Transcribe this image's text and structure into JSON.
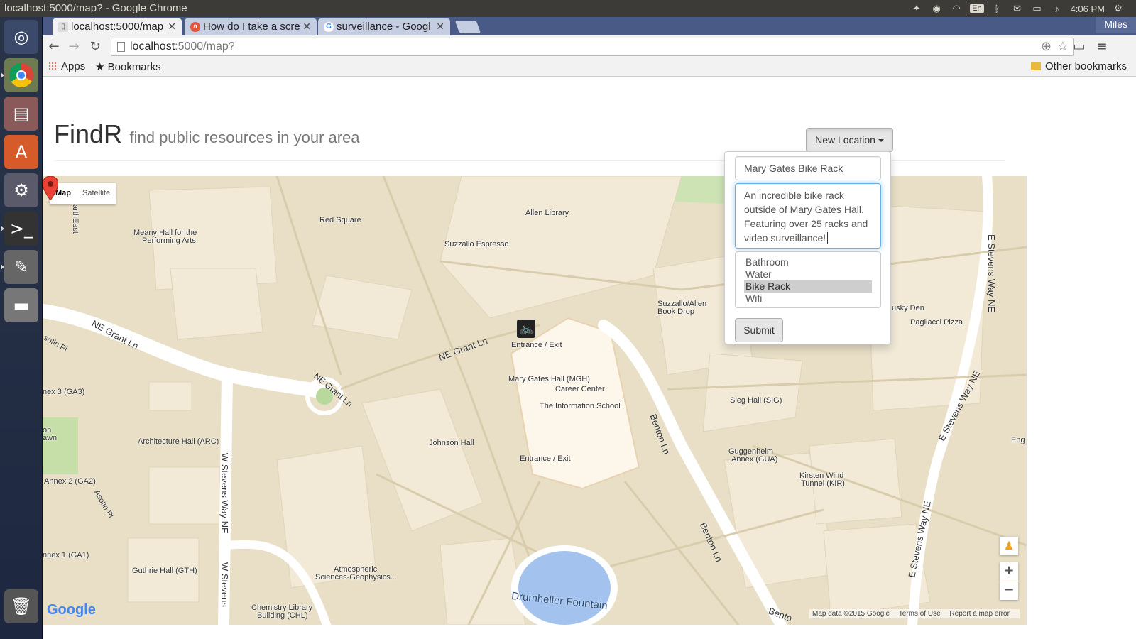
{
  "window": {
    "title": "localhost:5000/map? - Google Chrome"
  },
  "system_tray": {
    "input_method": "En",
    "clock": "4:06 PM"
  },
  "browser": {
    "profile": "Miles",
    "tabs": [
      {
        "label": "localhost:5000/map",
        "active": true
      },
      {
        "label": "How do I take a scre",
        "active": false
      },
      {
        "label": "surveillance - Googl",
        "active": false
      }
    ],
    "address": {
      "host": "localhost",
      "path": ":5000/map?"
    },
    "bookmarks": {
      "apps": "Apps",
      "bookmarks": "Bookmarks",
      "other": "Other bookmarks"
    }
  },
  "page": {
    "brand": "FindR",
    "tagline": "find public resources in your area",
    "new_location_button": "New Location"
  },
  "form": {
    "name_value": "Mary Gates Bike Rack",
    "description_value": "An incredible bike rack outside of Mary Gates Hall. Featuring over 25 racks and video surveillance!",
    "type_options": [
      "Bathroom",
      "Water",
      "Bike Rack",
      "Wifi"
    ],
    "type_selected": "Bike Rack",
    "submit_label": "Submit"
  },
  "map": {
    "type_map": "Map",
    "type_satellite": "Satellite",
    "zoom_in": "+",
    "zoom_out": "−",
    "logo": "Google",
    "footer": {
      "data": "Map data ©2015 Google",
      "terms": "Terms of Use",
      "report": "Report a map error"
    },
    "labels": {
      "meany": "Meany Hall for the",
      "meany2": "Performing Arts",
      "red_square": "Red Square",
      "allen": "Allen Library",
      "suzzallo_esp": "Suzzallo Espresso",
      "suzzallo_book": "Suzzallo/Allen",
      "suzzallo_book2": "Book Drop",
      "husky_den": "usky Den",
      "pagliacci": "Pagliacci Pizza",
      "entrance_top": "Entrance / Exit",
      "mgh": "Mary Gates Hall (MGH)",
      "career": "Career Center",
      "ischool": "The Information School",
      "entrance_bottom": "Entrance / Exit",
      "johnson": "Johnson Hall",
      "arch": "Architecture Hall (ARC)",
      "ga3": "nex 3 (GA3)",
      "ga2": "Annex 2 (GA2)",
      "ga1": "nnex 1 (GA1)",
      "guthrie": "Guthrie Hall (GTH)",
      "atmos": "Atmospheric",
      "atmos2": "Sciences-Geophysics...",
      "chem": "Chemistry Library",
      "chem2": "Building (CHL)",
      "drumheller": "Drumheller Fountain",
      "sieg": "Sieg Hall (SIG)",
      "gugg": "Guggenheim",
      "gugg2": "Annex (GUA)",
      "kirsten": "Kirsten Wind",
      "kirsten2": "Tunnel (KIR)",
      "eng": "Eng",
      "lawn": "on",
      "lawn2": "awn",
      "earthfront": "arthEast"
    },
    "roads": {
      "grant_left": "NE Grant Ln",
      "grant_right": "NE Grant Ln",
      "grant_circle": "NE Grant Ln",
      "asotin": "sotin Pl",
      "asotin2": "Asotin Pl",
      "wstevens1": "W Stevens Way NE",
      "wstevens2": "W Stevens",
      "benton1": "Benton Ln",
      "benton2": "Benton Ln",
      "benton3": "Bento",
      "estevens1": "E Stevens Way NE",
      "estevens2": "E Stevens Way NE",
      "estevens3": "E Stevens Way NE"
    }
  }
}
